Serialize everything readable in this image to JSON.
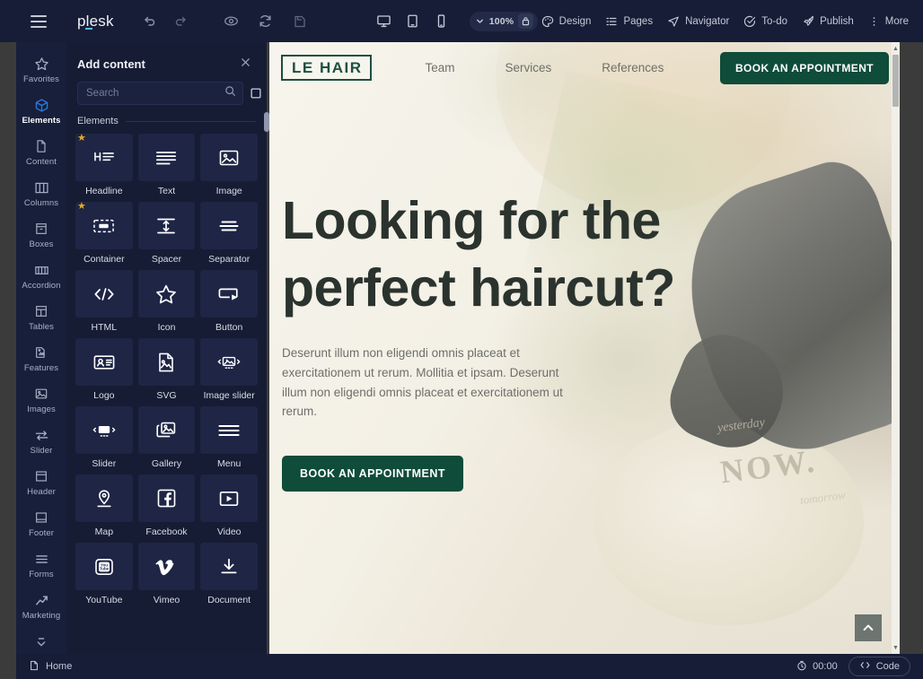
{
  "toolbar": {
    "brand": "plesk",
    "menu_icon": "hamburger-icon",
    "undo_label": "Undo",
    "redo_label": "Redo",
    "preview_label": "Preview",
    "reload_label": "Reload",
    "save_label": "Save",
    "devices": [
      {
        "name": "desktop",
        "label": "Desktop"
      },
      {
        "name": "tablet",
        "label": "Tablet"
      },
      {
        "name": "mobile",
        "label": "Mobile"
      }
    ],
    "zoom_level": "100%",
    "zoom_lock_icon": "lock-icon",
    "right_items": [
      {
        "label": "Design",
        "icon": "palette-icon"
      },
      {
        "label": "Pages",
        "icon": "list-icon"
      },
      {
        "label": "Navigator",
        "icon": "navigator-icon"
      },
      {
        "label": "To-do",
        "icon": "check-circle-icon"
      },
      {
        "label": "Publish",
        "icon": "rocket-icon"
      },
      {
        "label": "More",
        "icon": "dots-vertical-icon"
      }
    ]
  },
  "rail": {
    "items": [
      {
        "label": "Favorites",
        "icon": "star-icon",
        "active": false
      },
      {
        "label": "Elements",
        "icon": "cube-icon",
        "active": true
      },
      {
        "label": "Content",
        "icon": "document-icon",
        "active": false
      },
      {
        "label": "Columns",
        "icon": "columns-icon",
        "active": false
      },
      {
        "label": "Boxes",
        "icon": "box-icon",
        "active": false
      },
      {
        "label": "Accordion",
        "icon": "accordion-icon",
        "active": false
      },
      {
        "label": "Tables",
        "icon": "table-icon",
        "active": false
      },
      {
        "label": "Features",
        "icon": "features-icon",
        "active": false
      },
      {
        "label": "Images",
        "icon": "image-icon",
        "active": false
      },
      {
        "label": "Slider",
        "icon": "slider-icon",
        "active": false
      },
      {
        "label": "Header",
        "icon": "header-icon",
        "active": false
      },
      {
        "label": "Footer",
        "icon": "footer-icon",
        "active": false
      },
      {
        "label": "Forms",
        "icon": "forms-icon",
        "active": false
      },
      {
        "label": "Marketing",
        "icon": "trending-up-icon",
        "active": false
      }
    ],
    "more_icon": "chevron-down-icon",
    "home_label": "Home",
    "home_icon": "page-icon"
  },
  "panel": {
    "title": "Add content",
    "close_icon": "close-icon",
    "search_placeholder": "Search",
    "search_value": "",
    "search_icon": "search-icon",
    "view_list_icon": "list-view-icon",
    "view_grid_icon": "grid-view-icon",
    "section_label": "Elements",
    "tiles": [
      {
        "label": "Headline",
        "icon": "headline-icon",
        "favorite": true
      },
      {
        "label": "Text",
        "icon": "text-icon",
        "favorite": false
      },
      {
        "label": "Image",
        "icon": "image-icon",
        "favorite": false
      },
      {
        "label": "Container",
        "icon": "container-icon",
        "favorite": true
      },
      {
        "label": "Spacer",
        "icon": "spacer-icon",
        "favorite": false
      },
      {
        "label": "Separator",
        "icon": "separator-icon",
        "favorite": false
      },
      {
        "label": "HTML",
        "icon": "code-icon",
        "favorite": false
      },
      {
        "label": "Icon",
        "icon": "star-outline-icon",
        "favorite": false
      },
      {
        "label": "Button",
        "icon": "button-icon",
        "favorite": false
      },
      {
        "label": "Logo",
        "icon": "logo-icon",
        "favorite": false
      },
      {
        "label": "SVG",
        "icon": "svg-icon",
        "favorite": false
      },
      {
        "label": "Image slider",
        "icon": "image-slider-icon",
        "favorite": false
      },
      {
        "label": "Slider",
        "icon": "slider-icon",
        "favorite": false
      },
      {
        "label": "Gallery",
        "icon": "gallery-icon",
        "favorite": false
      },
      {
        "label": "Menu",
        "icon": "menu-icon",
        "favorite": false
      },
      {
        "label": "Map",
        "icon": "map-pin-icon",
        "favorite": false
      },
      {
        "label": "Facebook",
        "icon": "facebook-icon",
        "favorite": false
      },
      {
        "label": "Video",
        "icon": "video-icon",
        "favorite": false
      },
      {
        "label": "YouTube",
        "icon": "youtube-icon",
        "favorite": false
      },
      {
        "label": "Vimeo",
        "icon": "vimeo-icon",
        "favorite": false
      },
      {
        "label": "Document",
        "icon": "download-icon",
        "favorite": false
      }
    ]
  },
  "site": {
    "brand": "LE HAIR",
    "nav": [
      "Team",
      "Services",
      "References"
    ],
    "nav_cta": "BOOK AN APPOINTMENT",
    "hero_heading": "Looking for the perfect haircut?",
    "hero_text": "Deserunt illum non eligendi omnis placeat et exercitationem ut rerum. Mollitia et ipsam. Deserunt illum non eligendi omnis placeat et exercitationem ut rerum.",
    "hero_cta": "BOOK AN APPOINTMENT",
    "deco_now": "NOW.",
    "deco_yesterday": "yesterday",
    "deco_tomorrow": "tomorrow",
    "scrolltop_icon": "chevron-up-icon"
  },
  "statusbar": {
    "timer": "00:00",
    "timer_icon": "clock-icon",
    "code_label": "Code",
    "code_icon": "code-brackets-icon"
  },
  "colors": {
    "toolbar_bg": "#171d36",
    "panel_bg": "#161c33",
    "rail_bg": "#181f3b",
    "tile_bg": "#1e2545",
    "accent_blue": "#2a7de1",
    "star_gold": "#e8a81e",
    "site_green": "#0f4c3a",
    "hero_text": "#2b332e"
  }
}
